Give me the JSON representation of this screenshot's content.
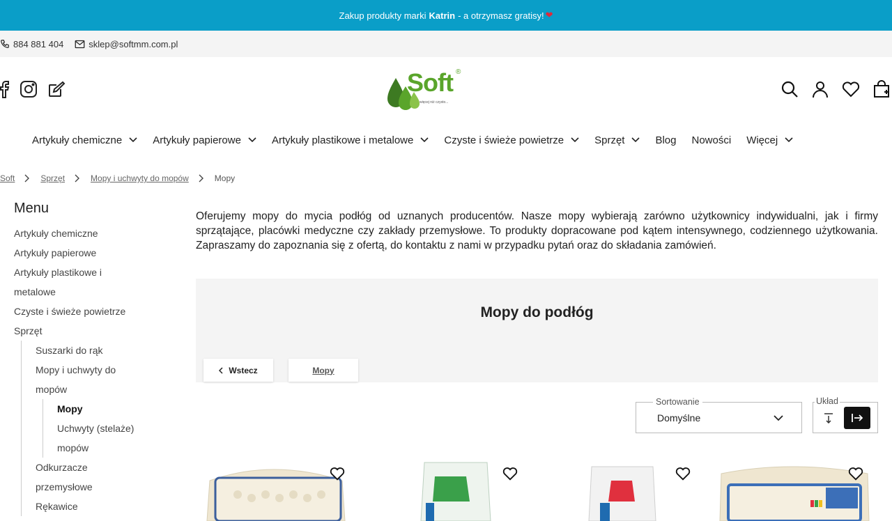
{
  "promo": {
    "prefix": "Zakup produkty marki",
    "brand": "Katrin",
    "suffix": "- a otrzymasz gratisy!",
    "heart": "❤"
  },
  "contact": {
    "phone": "884 881 404",
    "email": "sklep@softmm.com.pl"
  },
  "logo": {
    "word": "Soft",
    "reg": "®",
    "tagline": "więcej niż czysto..."
  },
  "nav": [
    {
      "label": "Artykuły chemiczne",
      "dropdown": true
    },
    {
      "label": "Artykuły papierowe",
      "dropdown": true
    },
    {
      "label": "Artykuły plastikowe i metalowe",
      "dropdown": true
    },
    {
      "label": "Czyste i świeże powietrze",
      "dropdown": true
    },
    {
      "label": "Sprzęt",
      "dropdown": true
    },
    {
      "label": "Blog",
      "dropdown": false
    },
    {
      "label": "Nowości",
      "dropdown": false
    },
    {
      "label": "Więcej",
      "dropdown": true
    }
  ],
  "breadcrumb": [
    "Soft",
    "Sprzęt",
    "Mopy i uchwyty do mopów",
    "Mopy"
  ],
  "sidebar": {
    "title": "Menu",
    "items": [
      "Artykuły chemiczne",
      "Artykuły papierowe",
      "Artykuły plastikowe i metalowe",
      "Czyste i świeże powietrze",
      "Sprzęt"
    ],
    "sub": [
      "Suszarki do rąk",
      "Mopy i uchwyty do mopów"
    ],
    "sub2": [
      "Mopy",
      "Uchwyty (stelaże) mopów"
    ],
    "sub_after": [
      "Odkurzacze przemysłowe",
      "Rękawice"
    ]
  },
  "intro": "Oferujemy mopy do mycia podłóg od uznanych producentów. Nasze mopy wybierają zarówno użytkownicy indywidualni, jak i firmy sprzątające, placówki medyczne czy zakłady przemysłowe. To produkty dopracowane pod kątem intensywnego, codziennego użytkowania. Zapraszamy do zapoznania się z ofertą, do kontaktu z nami w przypadku pytań oraz do składania zamówień.",
  "category": {
    "title": "Mopy do podłóg",
    "back_label": "Wstecz",
    "current_label": "Mopy"
  },
  "sort": {
    "label": "Sortowanie",
    "value": "Domyślne"
  },
  "layout": {
    "label": "Układ"
  },
  "colors": {
    "promo_bg": "#0a9ec8",
    "brand_green": "#5aa52b",
    "heart": "#e02a3a"
  }
}
